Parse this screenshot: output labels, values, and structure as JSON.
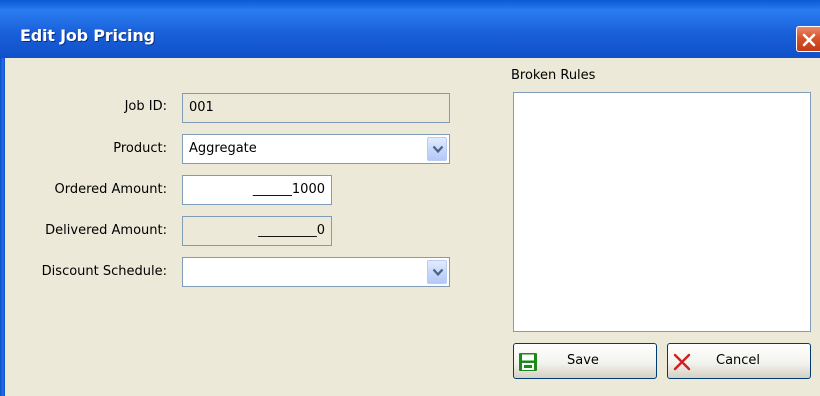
{
  "window": {
    "title": "Edit Job Pricing"
  },
  "form": {
    "job_id": {
      "label": "Job ID:",
      "value": "001"
    },
    "product": {
      "label": "Product:",
      "value": "Aggregate"
    },
    "ordered_amount": {
      "label": "Ordered Amount:",
      "value": "______1000"
    },
    "delivered_amount": {
      "label": "Delivered Amount:",
      "value": "_________0"
    },
    "discount_schedule": {
      "label": "Discount Schedule:",
      "value": ""
    }
  },
  "broken_rules": {
    "label": "Broken Rules"
  },
  "buttons": {
    "save": {
      "label": "Save",
      "icon": "floppy-disk-icon",
      "color": "#1a8a1a"
    },
    "cancel": {
      "label": "Cancel",
      "icon": "red-x-icon",
      "color": "#d02020"
    }
  },
  "colors": {
    "titlebar": "#0a5ad6",
    "dialog_bg": "#ece9d8",
    "field_border": "#7f9db9"
  }
}
